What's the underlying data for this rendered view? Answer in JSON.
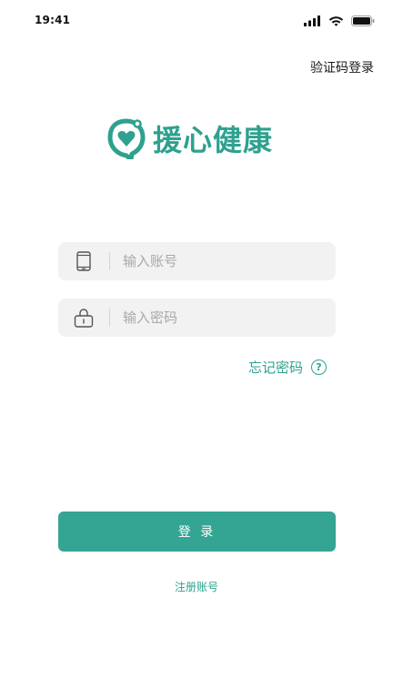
{
  "status_bar": {
    "time": "19:41",
    "icons": [
      "signal-icon",
      "wifi-icon",
      "battery-icon"
    ]
  },
  "header": {
    "sms_login_link": "验证码登录"
  },
  "logo": {
    "icon": "heart-bubble-logo-icon",
    "app_name": "援心健康"
  },
  "form": {
    "account": {
      "icon": "phone-icon",
      "placeholder": "输入账号",
      "value": ""
    },
    "password": {
      "icon": "lock-icon",
      "placeholder": "输入密码",
      "value": ""
    },
    "forgot_password": {
      "label": "忘记密码",
      "icon": "question-icon"
    }
  },
  "actions": {
    "login_label": "登 录",
    "register_label": "注册账号"
  },
  "colors": {
    "brand": "#2ea18f",
    "button": "#34a493",
    "field_bg": "#f2f2f2"
  }
}
